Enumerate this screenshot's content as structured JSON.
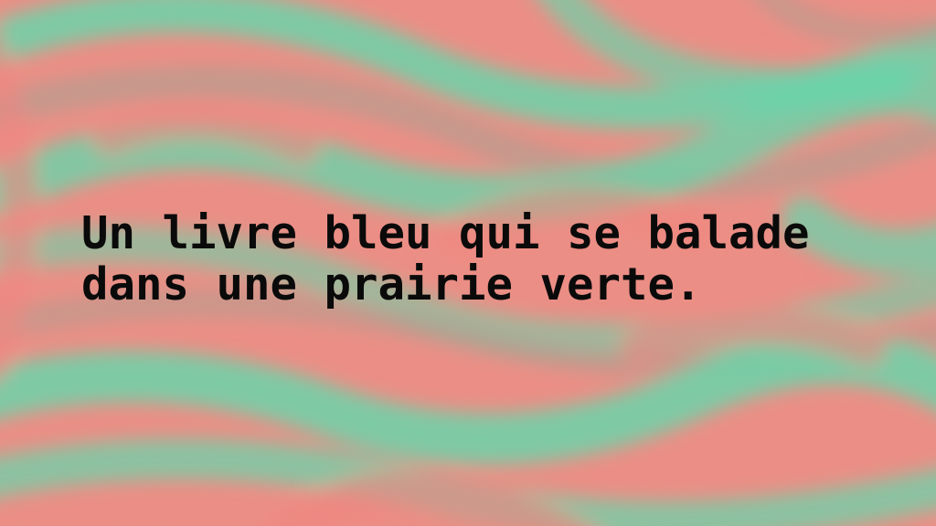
{
  "caption": {
    "lines": [
      "Un livre bleu qui se balade",
      "dans une prairie verte."
    ]
  },
  "background": {
    "colors": {
      "coral": "#f58079",
      "mint": "#63d6a8",
      "taupe": "#b39a8a"
    },
    "style": "swirling brush strokes texture"
  }
}
